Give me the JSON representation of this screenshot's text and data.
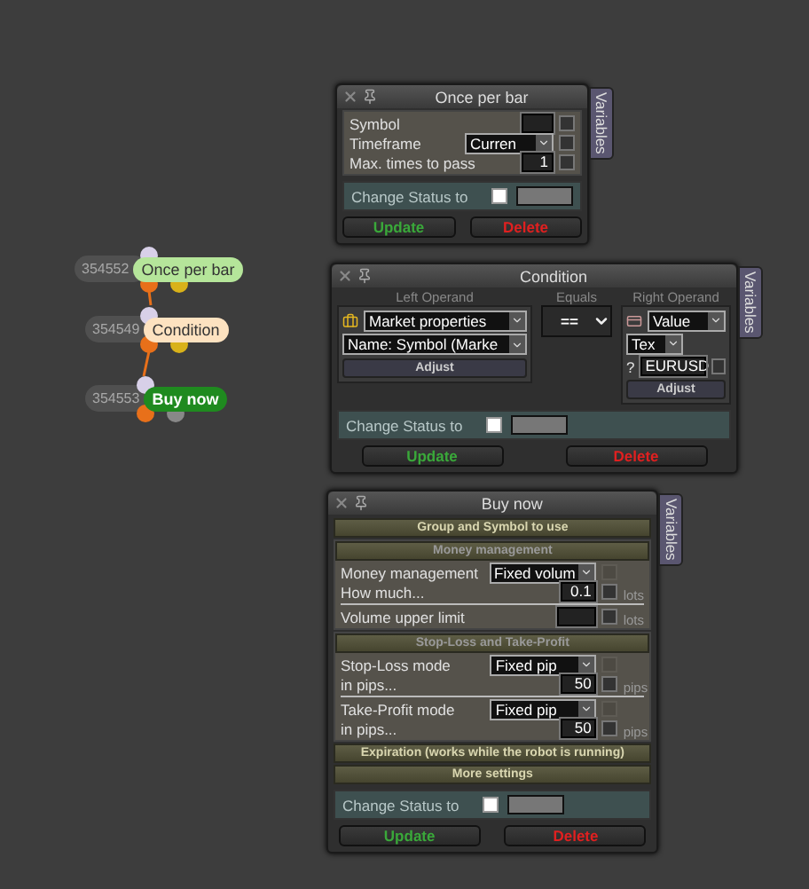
{
  "nodes": [
    {
      "id": "354552",
      "label": "Once per bar",
      "color": "#b5e59a"
    },
    {
      "id": "354549",
      "label": "Condition",
      "color": "#fde2c0"
    },
    {
      "id": "354553",
      "label": "Buy now",
      "color": "#1f8a1f"
    }
  ],
  "once_per_bar": {
    "title": "Once per bar",
    "side_tab": "Variables",
    "fields": [
      {
        "kind": "input",
        "label": "Symbol",
        "checked": false
      },
      {
        "kind": "select",
        "label": "Timeframe",
        "value": "Curren",
        "checked": false
      },
      {
        "kind": "input",
        "label": "Max. times to pass",
        "value": "1",
        "checked": false
      }
    ],
    "status": {
      "label": "Change Status to",
      "checked": false
    },
    "buttons": [
      {
        "kind": "update",
        "label": "Update"
      },
      {
        "kind": "delete",
        "label": "Delete"
      }
    ]
  },
  "condition": {
    "title": "Condition",
    "side_tab": "Variables",
    "left_operand": {
      "heading": "Left Operand",
      "source": "Market properties",
      "property": "Name: Symbol (Marke",
      "button": "Adjust"
    },
    "operator": {
      "heading": "Equals",
      "value": "=="
    },
    "right_operand": {
      "heading": "Right Operand",
      "source": "Value",
      "type": "Tex",
      "prefix": "?",
      "value": "EURUSD",
      "checked": false,
      "button": "Adjust"
    },
    "status": {
      "label": "Change Status to",
      "checked": false
    },
    "buttons": [
      {
        "kind": "update",
        "label": "Update"
      },
      {
        "kind": "delete",
        "label": "Delete"
      }
    ]
  },
  "buy_now": {
    "title": "Buy now",
    "side_tab": "Variables",
    "sections": [
      {
        "kind": "header",
        "title": "Group and Symbol to use"
      },
      {
        "kind": "group",
        "title": "Money management",
        "rows": [
          {
            "kind": "select",
            "label": "Money management",
            "value": "Fixed volum",
            "checked": false,
            "disabled": true
          },
          {
            "kind": "input",
            "label": "How much...",
            "value": "0.1",
            "unit": "lots",
            "checked": false
          },
          {
            "kind": "divider"
          },
          {
            "kind": "input",
            "label": "Volume upper limit",
            "unit": "lots",
            "checked": false
          }
        ]
      },
      {
        "kind": "group",
        "title": "Stop-Loss and Take-Profit",
        "rows": [
          {
            "kind": "select",
            "label": "Stop-Loss mode",
            "value": "Fixed pip",
            "checked": false,
            "disabled": true
          },
          {
            "kind": "input",
            "label": "in pips...",
            "value": "50",
            "unit": "pips",
            "checked": false
          },
          {
            "kind": "divider"
          },
          {
            "kind": "select",
            "label": "Take-Profit mode",
            "value": "Fixed pip",
            "checked": false,
            "disabled": true
          },
          {
            "kind": "input",
            "label": "in pips...",
            "value": "50",
            "unit": "pips",
            "checked": false
          }
        ]
      },
      {
        "kind": "header",
        "title": "Expiration (works while the robot is running)"
      },
      {
        "kind": "header",
        "title": "More settings"
      }
    ],
    "status": {
      "label": "Change Status to",
      "checked": false
    },
    "buttons": [
      {
        "kind": "update",
        "label": "Update"
      },
      {
        "kind": "delete",
        "label": "Delete"
      }
    ]
  }
}
